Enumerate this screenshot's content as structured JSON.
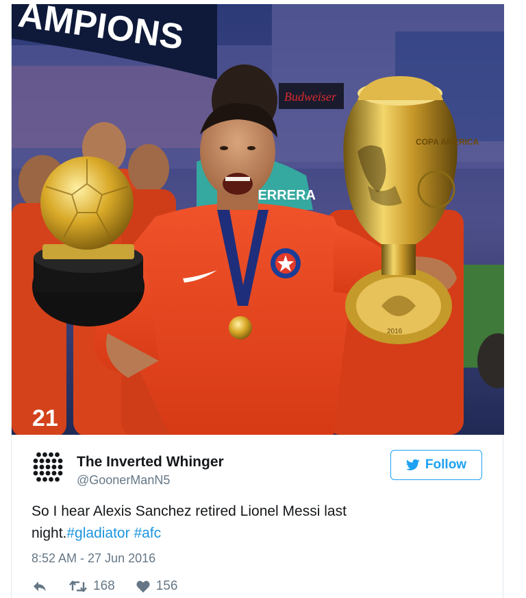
{
  "photo": {
    "banner_text": "AMPIONS",
    "sponsor_text": "Budweiser",
    "jersey_name": "HERRERA",
    "shorts_number": "21",
    "trophy_engraving": "COPA AMERICA",
    "trophy_year": "2016"
  },
  "tweet": {
    "display_name": "The Inverted Whinger",
    "handle": "@GoonerManN5",
    "follow_label": "Follow",
    "text_prefix": "So I hear Alexis Sanchez retired Lionel Messi last night.",
    "hashtags": [
      "#gladiator",
      "#afc"
    ],
    "timestamp": "8:52 AM - 27 Jun 2016",
    "retweet_count": "168",
    "like_count": "156"
  },
  "icons": {
    "avatar": "dot-grid-avatar-icon",
    "follow": "twitter-bird-icon",
    "reply": "reply-icon",
    "retweet": "retweet-icon",
    "like": "heart-icon"
  },
  "colors": {
    "brand_blue": "#1da1f2",
    "hashtag_blue": "#1b95e0",
    "text": "#14171a",
    "muted": "#657786",
    "jersey_red": "#e4451c"
  }
}
